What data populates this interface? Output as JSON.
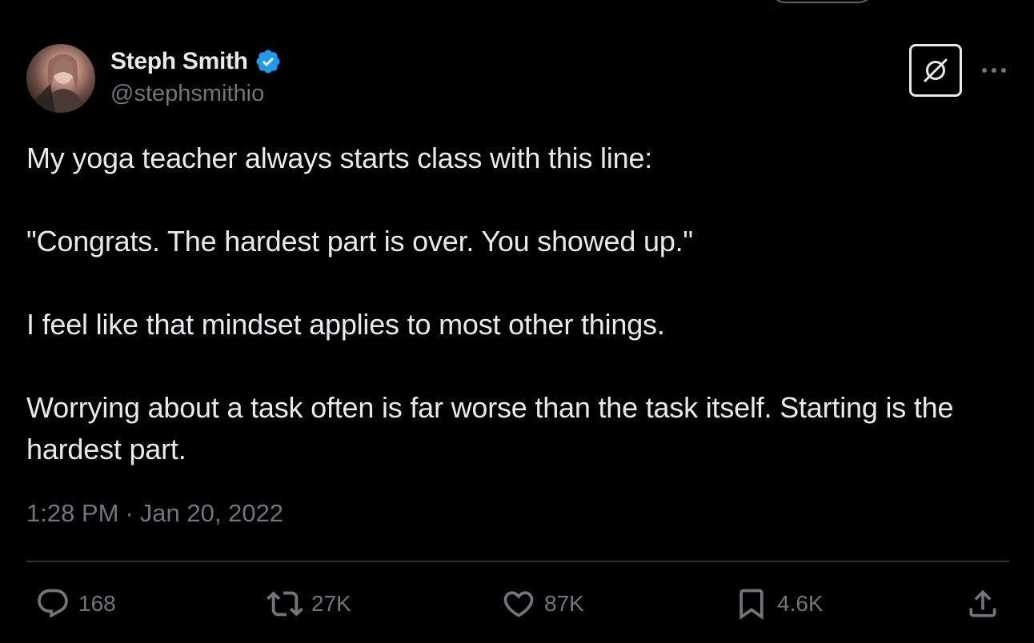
{
  "tweet": {
    "author_name": "Steph Smith",
    "handle": "@stephsmithio",
    "verified": true,
    "paragraphs": [
      "My yoga teacher always starts class with this line:",
      "\"Congrats. The hardest part is over. You showed up.\"",
      "I feel like that mindset applies to most other things.",
      "Worrying about a task often is far worse than the task itself. Starting is the hardest part."
    ],
    "time": "1:28 PM",
    "separator": "·",
    "date": "Jan 20, 2022"
  },
  "actions": {
    "replies": "168",
    "reposts": "27K",
    "likes": "87K",
    "bookmarks": "4.6K"
  },
  "icons": {
    "verified": "verified-badge-icon",
    "grok": "grok-icon",
    "more": "more-dots-icon",
    "reply": "reply-icon",
    "repost": "repost-icon",
    "like": "heart-icon",
    "bookmark": "bookmark-icon",
    "share": "share-icon"
  },
  "colors": {
    "background": "#000000",
    "text_primary": "#e7e9ea",
    "text_secondary": "#71767b",
    "verified_blue": "#1d9bf0",
    "divider": "#2f3336"
  }
}
